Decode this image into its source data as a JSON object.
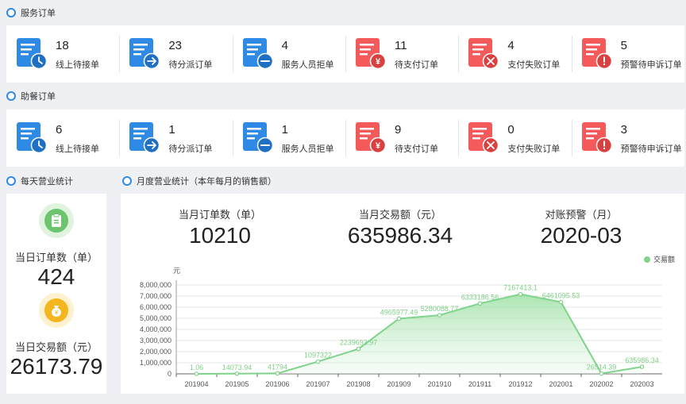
{
  "service_orders": {
    "title": "服务订单",
    "stats": [
      {
        "value": "18",
        "label": "线上待接单",
        "icon": "clock-doc-icon"
      },
      {
        "value": "23",
        "label": "待分派订单",
        "icon": "arrow-doc-icon"
      },
      {
        "value": "4",
        "label": "服务人员拒单",
        "icon": "minus-doc-icon"
      },
      {
        "value": "11",
        "label": "待支付订单",
        "icon": "yen-doc-icon"
      },
      {
        "value": "4",
        "label": "支付失败订单",
        "icon": "cross-doc-icon"
      },
      {
        "value": "5",
        "label": "预警待申诉订单",
        "icon": "alert-doc-icon"
      }
    ]
  },
  "meal_orders": {
    "title": "助餐订单",
    "stats": [
      {
        "value": "6",
        "label": "线上待接单",
        "icon": "clock-doc-icon"
      },
      {
        "value": "1",
        "label": "待分派订单",
        "icon": "arrow-doc-icon"
      },
      {
        "value": "1",
        "label": "服务人员拒单",
        "icon": "minus-doc-icon"
      },
      {
        "value": "9",
        "label": "待支付订单",
        "icon": "yen-doc-icon"
      },
      {
        "value": "0",
        "label": "支付失败订单",
        "icon": "cross-doc-icon"
      },
      {
        "value": "3",
        "label": "预警待申诉订单",
        "icon": "alert-doc-icon"
      }
    ]
  },
  "daily": {
    "title": "每天营业统计",
    "orders_label": "当日订单数（单）",
    "orders_value": "424",
    "revenue_label": "当日交易额（元）",
    "revenue_value": "26173.79"
  },
  "monthly": {
    "title": "月度营业统计（本年每月的销售额）",
    "kpis": [
      {
        "label": "当月订单数（单）",
        "value": "10210"
      },
      {
        "label": "当月交易额（元）",
        "value": "635986.34"
      },
      {
        "label": "对账预警（月）",
        "value": "2020-03"
      }
    ]
  },
  "colors": {
    "blue_icon": "#2f8ae5",
    "red_icon": "#f45a5a",
    "chart_line": "#7fd38a",
    "ring": "#2f8ae5"
  },
  "chart_data": {
    "type": "area",
    "ylabel": "元",
    "legend": "交易额",
    "legend_position": "top-right",
    "categories": [
      "201904",
      "201905",
      "201906",
      "201907",
      "201908",
      "201909",
      "201910",
      "201911",
      "201912",
      "202001",
      "202002",
      "202003"
    ],
    "values": [
      1.06,
      14073.94,
      41794,
      1097322,
      2239693.97,
      4965977.49,
      5280088.77,
      6333186.56,
      7167413.1,
      6461095.53,
      26514.39,
      635986.34
    ],
    "labels": [
      "1.06",
      "14073.94",
      "41794",
      "1097322",
      "2239693.97",
      "4965977.49",
      "5280088.77",
      "6333186.56",
      "7167413.1",
      "6461095.53",
      "26514.39",
      "635986.34"
    ],
    "yticks": [
      "0",
      "1,000,000",
      "2,000,000",
      "3,000,000",
      "4,000,000",
      "5,000,000",
      "6,000,000",
      "7,000,000",
      "8,000,000"
    ],
    "ylim": [
      0,
      8000000
    ],
    "grid": true
  }
}
